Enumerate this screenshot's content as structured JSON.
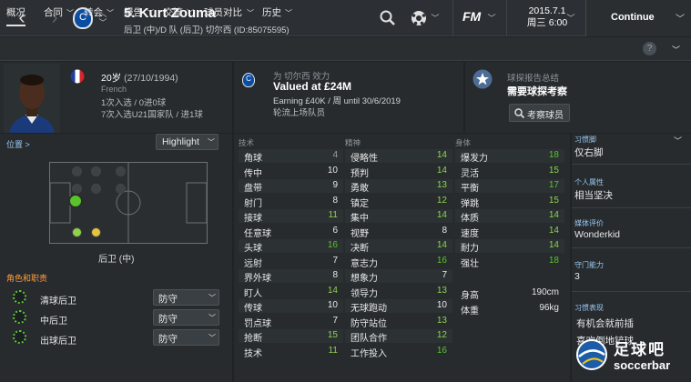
{
  "header": {
    "name": "5. Kurt Zouma",
    "subtitle": "后卫 (中)/D 队 (后卫)  切尔西 (ID:85075595)",
    "crest_text": "C",
    "date": "2015.7.1",
    "time": "周三 6:00",
    "continue_label": "Continue",
    "fm_logo": "FM"
  },
  "tabs": [
    "概况",
    "合同",
    "转会",
    "报告",
    "交流",
    "球员对比",
    "历史"
  ],
  "help_label": "?",
  "profile": {
    "age": "20岁",
    "dob": "(27/10/1994)",
    "nationality": "French",
    "caps_line1": "1次入选 / 0进0球",
    "caps_line2": "7次入选U21国家队 / 进1球"
  },
  "club": {
    "plays_for": "为 切尔西 效力",
    "value": "Valued at £24M",
    "earning": "Earning £40K / 周  until 30/6/2019",
    "squad": "轮流上场队员"
  },
  "scout": {
    "title": "球探报告总结",
    "need": "需要球探考察",
    "button": "考察球员"
  },
  "position": {
    "label": "位置 >",
    "dropdown": "Highlight",
    "pos_name": "后卫 (中)"
  },
  "roles": {
    "header": "角色和职责",
    "items": [
      {
        "name": "清球后卫",
        "duty": "防守"
      },
      {
        "name": "中后卫",
        "duty": "防守"
      },
      {
        "name": "出球后卫",
        "duty": "防守"
      }
    ]
  },
  "attributes": {
    "technical": {
      "header": "技术",
      "items": [
        [
          "角球",
          "4"
        ],
        [
          "传中",
          "10"
        ],
        [
          "盘带",
          "9"
        ],
        [
          "射门",
          "8"
        ],
        [
          "接球",
          "11"
        ],
        [
          "任意球",
          "6"
        ],
        [
          "头球",
          "16"
        ],
        [
          "远射",
          "7"
        ],
        [
          "界外球",
          "8"
        ],
        [
          "盯人",
          "14"
        ],
        [
          "传球",
          "10"
        ],
        [
          "罚点球",
          "7"
        ],
        [
          "抢断",
          "15"
        ],
        [
          "技术",
          "11"
        ]
      ]
    },
    "mental": {
      "header": "精神",
      "items": [
        [
          "侵略性",
          "14"
        ],
        [
          "预判",
          "14"
        ],
        [
          "勇敢",
          "13"
        ],
        [
          "镇定",
          "12"
        ],
        [
          "集中",
          "14"
        ],
        [
          "视野",
          "8"
        ],
        [
          "决断",
          "14"
        ],
        [
          "意志力",
          "16"
        ],
        [
          "想象力",
          "7"
        ],
        [
          "领导力",
          "13"
        ],
        [
          "无球跑动",
          "10"
        ],
        [
          "防守站位",
          "13"
        ],
        [
          "团队合作",
          "12"
        ],
        [
          "工作投入",
          "16"
        ]
      ]
    },
    "physical": {
      "header": "身体",
      "items": [
        [
          "爆发力",
          "18"
        ],
        [
          "灵活",
          "15"
        ],
        [
          "平衡",
          "17"
        ],
        [
          "弹跳",
          "15"
        ],
        [
          "体质",
          "14"
        ],
        [
          "速度",
          "14"
        ],
        [
          "耐力",
          "14"
        ],
        [
          "强壮",
          "18"
        ]
      ]
    }
  },
  "body": {
    "height_label": "身高",
    "height": "190cm",
    "weight_label": "体重",
    "weight": "96kg"
  },
  "sidebar": {
    "footedness_label": "习惯脚",
    "footedness": "仅右脚",
    "personality_label": "个人属性",
    "personality": "相当坚决",
    "media_label": "媒体评价",
    "media": "Wonderkid",
    "consistency_label": "守门能力",
    "consistency": "3",
    "habits_label": "习惯表现",
    "habits": [
      "有机会就前插",
      "喜欢倒地铲球"
    ]
  },
  "watermark": {
    "cn": "足球吧",
    "en": "soccerbar"
  },
  "colors": {
    "green": "#56c42a",
    "lightgreen": "#8dd34a",
    "yellow": "#e8c23a",
    "white": "#e8e8e8",
    "accent_blue": "#9ac7ee"
  }
}
